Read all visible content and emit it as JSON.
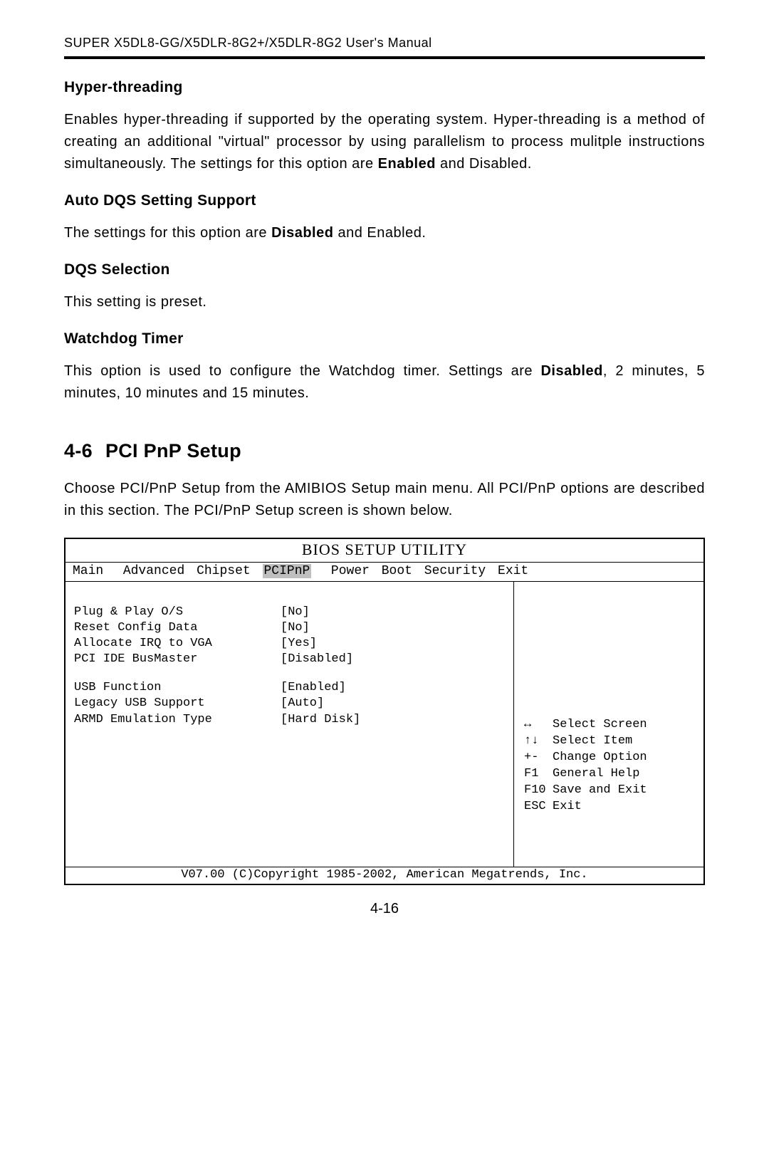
{
  "header": "SUPER X5DL8-GG/X5DLR-8G2+/X5DLR-8G2 User's Manual",
  "sections": {
    "hyperthreading_title": "Hyper-threading",
    "hyperthreading_pre": "Enables hyper-threading if supported by the operating system.  Hyper-threading is a method of creating an additional \"virtual\" processor by using parallelism to process mulitple instructions simultaneously.  The settings for this option are ",
    "hyperthreading_bold": "Enabled",
    "hyperthreading_post": " and Disabled.",
    "autodqs_title": "Auto DQS Setting Support",
    "autodqs_pre": "The settings for this option are ",
    "autodqs_bold": "Disabled",
    "autodqs_post": " and Enabled.",
    "dqssel_title": "DQS Selection",
    "dqssel_body": "This setting is preset.",
    "watchdog_title": "Watchdog Timer",
    "watchdog_pre": "This option is used to configure the Watchdog timer.  Settings are ",
    "watchdog_bold": "Disabled",
    "watchdog_post": ", 2 minutes, 5 minutes, 10 minutes and 15 minutes."
  },
  "chapter": {
    "number": "4-6",
    "title": "PCI PnP Setup",
    "intro": "Choose PCI/PnP Setup from the AMIBIOS Setup main menu.  All PCI/PnP options are described in this section.  The PCI/PnP Setup screen is shown below."
  },
  "bios": {
    "title": "BIOS SETUP UTILITY",
    "menu": {
      "main": "Main",
      "advanced": "Advanced",
      "chipset": "Chipset",
      "pcipnp": "PCIPnP",
      "power": "Power",
      "boot": "Boot",
      "security": "Security",
      "exit": "Exit"
    },
    "options": [
      {
        "label": "Plug & Play O/S",
        "value": "[No]"
      },
      {
        "label": "Reset Config Data",
        "value": "[No]"
      },
      {
        "label": "Allocate IRQ to VGA",
        "value": "[Yes]"
      },
      {
        "label": "PCI IDE BusMaster",
        "value": "[Disabled]"
      }
    ],
    "options2": [
      {
        "label": "USB Function",
        "value": "[Enabled]"
      },
      {
        "label": "Legacy USB Support",
        "value": "[Auto]"
      },
      {
        "label": "ARMD Emulation Type",
        "value": "[Hard Disk]"
      }
    ],
    "nav": [
      {
        "key": "↔",
        "desc": "Select Screen"
      },
      {
        "key": "↑↓",
        "desc": "Select Item"
      },
      {
        "key": "+-",
        "desc": "Change Option"
      },
      {
        "key": "F1",
        "desc": "General Help"
      },
      {
        "key": "F10",
        "desc": "Save and Exit"
      },
      {
        "key": "ESC",
        "desc": "Exit"
      }
    ],
    "footer": "V07.00 (C)Copyright 1985-2002, American Megatrends, Inc."
  },
  "page_number": "4-16"
}
